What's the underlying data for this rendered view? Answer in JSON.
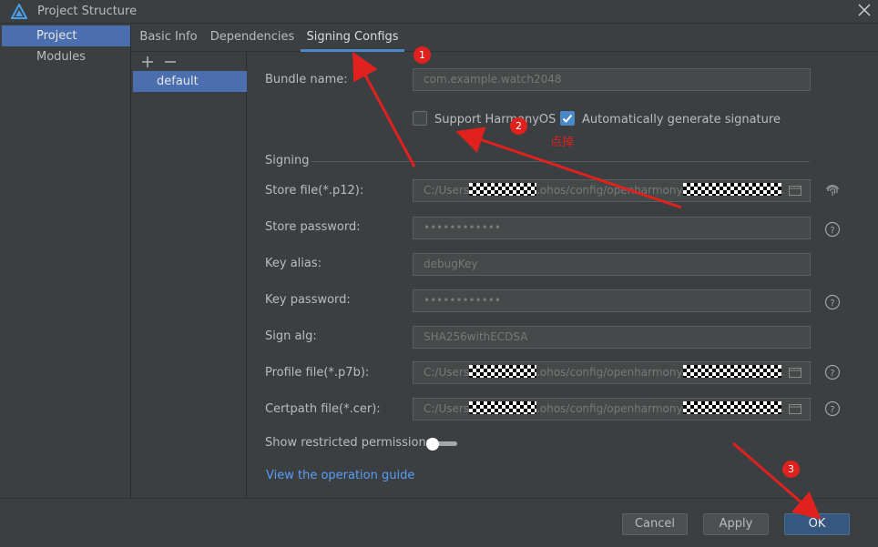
{
  "window": {
    "title": "Project Structure"
  },
  "sidebar": {
    "items": [
      {
        "label": "Project"
      },
      {
        "label": "Modules"
      }
    ]
  },
  "tabs": [
    {
      "label": "Basic Info"
    },
    {
      "label": "Dependencies"
    },
    {
      "label": "Signing Configs"
    }
  ],
  "configs": {
    "items": [
      {
        "label": "default"
      }
    ]
  },
  "form": {
    "bundle_name": {
      "label": "Bundle name:",
      "placeholder": "com.example.watch2048"
    },
    "support_harmonyos": {
      "label": "Support HarmonyOS",
      "checked": false
    },
    "auto_signature": {
      "label": "Automatically generate signature",
      "checked": true
    },
    "signing_section": "Signing",
    "store_file": {
      "label": "Store file(*.p12):",
      "prefix": "C:/Users",
      "middle": ".ohos/config/openharmony",
      "suffix": "."
    },
    "store_password": {
      "label": "Store password:",
      "value": "••••••••••••"
    },
    "key_alias": {
      "label": "Key alias:",
      "value": "debugKey"
    },
    "key_password": {
      "label": "Key password:",
      "value": "••••••••••••"
    },
    "sign_alg": {
      "label": "Sign alg:",
      "value": "SHA256withECDSA"
    },
    "profile_file": {
      "label": "Profile file(*.p7b):",
      "prefix": "C:/Users",
      "middle": ".ohos/config/openharmony",
      "suffix": "."
    },
    "certpath_file": {
      "label": "Certpath file(*.cer):",
      "prefix": "C:/Users",
      "middle": ".ohos/config/openharmony",
      "suffix": "."
    },
    "show_restricted": {
      "label": "Show restricted permissions",
      "enabled": false
    },
    "guide_link": "View the operation guide"
  },
  "footer": {
    "cancel": "Cancel",
    "apply": "Apply",
    "ok": "OK"
  },
  "annotations": {
    "badge1": "1",
    "badge2": "2",
    "badge3": "3",
    "note": "点掉"
  },
  "colors": {
    "accent": "#4a88c7",
    "selection": "#4b6eaf",
    "annotation": "#e0211d"
  }
}
